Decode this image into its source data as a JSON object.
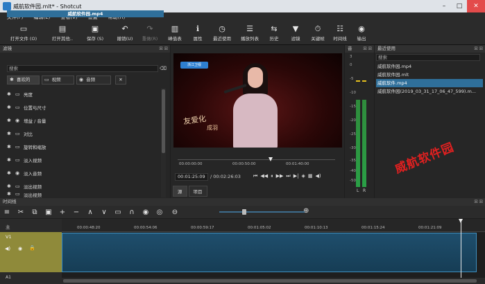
{
  "window": {
    "title": "威航软件园.mlt* - Shotcut",
    "min": "–",
    "max": "□",
    "close": "✕"
  },
  "menu": [
    "文件(F)",
    "编辑(E)",
    "查看(V)",
    "设置",
    "帮助(H)"
  ],
  "toolbar": [
    {
      "label": "打开文件 (O)",
      "icon": "▭"
    },
    {
      "label": "打开其他..",
      "icon": "▤"
    },
    {
      "label": "保存 (S)",
      "icon": "▣"
    },
    {
      "label": "撤销(U)",
      "icon": "↶"
    },
    {
      "label": "重做(R)",
      "icon": "↷"
    },
    {
      "label": "峰值表",
      "icon": "▥"
    },
    {
      "label": "属性",
      "icon": "ℹ"
    },
    {
      "label": "最近使用",
      "icon": "◷"
    },
    {
      "label": "播放列表",
      "icon": "☰"
    },
    {
      "label": "历史",
      "icon": "⇆"
    },
    {
      "label": "滤镜",
      "icon": "▼"
    },
    {
      "label": "关键帧",
      "icon": "⏱"
    },
    {
      "label": "时间线",
      "icon": "☷"
    },
    {
      "label": "输出",
      "icon": "◉"
    }
  ],
  "filters": {
    "header": "滤镜",
    "panel_ctrls": "☒ ☒",
    "clip_name": "威航软件园.mp4",
    "search_placeholder": "搜索",
    "search_clear": "⌫",
    "tabs": [
      {
        "label": "喜欢的",
        "icon": "✱"
      },
      {
        "label": "视频",
        "icon": "▭"
      },
      {
        "label": "音频",
        "icon": "◉"
      }
    ],
    "close_tab": "✕",
    "items": [
      {
        "label": "亮度",
        "icon": "▭"
      },
      {
        "label": "位置与尺寸",
        "icon": "▭"
      },
      {
        "label": "增益 / 音量",
        "icon": "◉"
      },
      {
        "label": "对比",
        "icon": "▭"
      },
      {
        "label": "旋转和缩放",
        "icon": "▭"
      },
      {
        "label": "淡入视频",
        "icon": "▭"
      },
      {
        "label": "淡入音频",
        "icon": "◉"
      },
      {
        "label": "淡出视频",
        "icon": "▭"
      },
      {
        "label": "淡出视频",
        "icon": "▭"
      }
    ]
  },
  "player": {
    "channel_logo": "浙江卫视",
    "caption_main": "友爱化",
    "caption_sub": "成羽",
    "ruler": [
      "00:00:00:00",
      "00:00:50:00",
      "00:01:40:00"
    ],
    "current_tc": "00:01:25:09",
    "total_tc": "/ 00:02:26:03",
    "transport": [
      "⏮",
      "◀◀",
      "⏸",
      "▶▶",
      "⏭",
      "▶|",
      "◈",
      "▦",
      "◀)"
    ],
    "tabs": [
      "源",
      "项目"
    ]
  },
  "meter": {
    "header": "音",
    "scale": [
      "3",
      "0",
      "-5",
      "-10",
      "-15",
      "-20",
      "-25",
      "-30",
      "-35",
      "-40",
      "-50"
    ],
    "left_label": "L",
    "right_label": "R",
    "levels": {
      "L": 0.72,
      "R": 0.72
    }
  },
  "recent": {
    "header": "最近使用",
    "search_placeholder": "搜索",
    "items": [
      "威航软件园.mp4",
      "威航软件园.mlt",
      "威航软件.mp4",
      "威航软件园(2019_03_31_17_06_47_599).m..."
    ],
    "selected_index": 2
  },
  "watermark": "威航软件园",
  "timeline": {
    "header": "时间线",
    "tools": [
      "≡",
      "✂",
      "⧉",
      "▣",
      "+",
      "−",
      "∧",
      "∨",
      "▭",
      "∩",
      "◉",
      "◎",
      "⊖",
      "⊕"
    ],
    "zoom_level": 0.27,
    "main_label": "主",
    "ruler": [
      "00:00:48:20",
      "00:00:54:06",
      "00:00:59:17",
      "00:01:05:02",
      "00:01:10:13",
      "00:01:15:24",
      "00:01:21:09"
    ],
    "tracks": {
      "v1": "V1",
      "a1": "A1"
    },
    "track_icons": [
      "◀)",
      "◉",
      "🔒"
    ]
  }
}
